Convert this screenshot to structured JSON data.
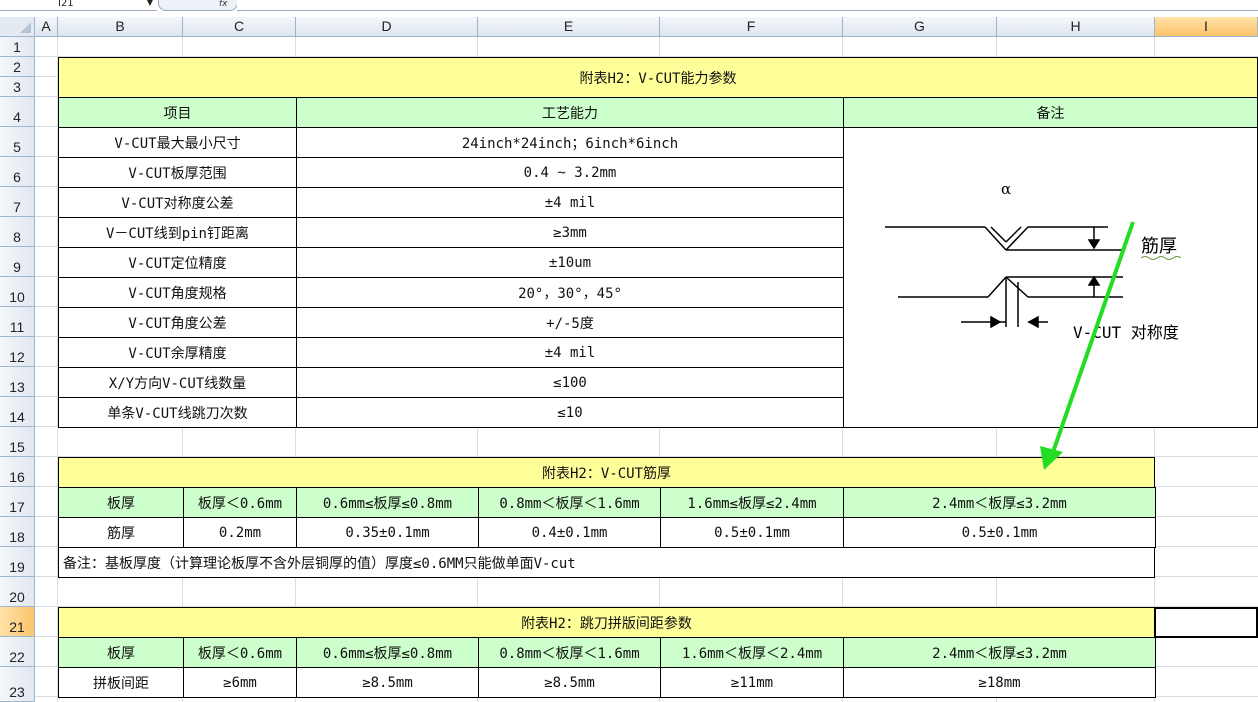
{
  "name_box": {
    "value": "I21"
  },
  "formula_bar": {
    "fx_label": "fx",
    "value": ""
  },
  "columns": [
    {
      "id": "col-a",
      "label": "A"
    },
    {
      "id": "col-b",
      "label": "B"
    },
    {
      "id": "col-c",
      "label": "C"
    },
    {
      "id": "col-d",
      "label": "D"
    },
    {
      "id": "col-e",
      "label": "E"
    },
    {
      "id": "col-f",
      "label": "F"
    },
    {
      "id": "col-g",
      "label": "G"
    },
    {
      "id": "col-h",
      "label": "H"
    },
    {
      "id": "col-i",
      "label": "I"
    }
  ],
  "rows": [
    "1",
    "2",
    "3",
    "4",
    "5",
    "6",
    "7",
    "8",
    "9",
    "10",
    "11",
    "12",
    "13",
    "14",
    "15",
    "16",
    "17",
    "18",
    "19",
    "20",
    "21",
    "22",
    "23"
  ],
  "selected": {
    "column": "I",
    "row": "21"
  },
  "colors": {
    "title_fill": "#ffff99",
    "header_fill": "#ccffcc",
    "selected_header": "#fbc46a",
    "arrow": "#22dd22"
  },
  "table1": {
    "title": "附表H2：V-CUT能力参数",
    "headers": {
      "item": "项目",
      "capability": "工艺能力",
      "remark": "备注"
    },
    "rows": [
      {
        "item": "V-CUT最大最小尺寸",
        "value": "24inch*24inch；6inch*6inch"
      },
      {
        "item": "V-CUT板厚范围",
        "value": "0.4 ~ 3.2mm"
      },
      {
        "item": "V-CUT对称度公差",
        "value": "±4 mil"
      },
      {
        "item": "V－CUT线到pin钉距离",
        "value": "≥3mm"
      },
      {
        "item": "V-CUT定位精度",
        "value": "±10um"
      },
      {
        "item": "V-CUT角度规格",
        "value": "20°，30°，45°"
      },
      {
        "item": "V-CUT角度公差",
        "value": "+/-5度"
      },
      {
        "item": "V-CUT余厚精度",
        "value": "±4 mil"
      },
      {
        "item": "X/Y方向V-CUT线数量",
        "value": "≤100"
      },
      {
        "item": "单条V-CUT线跳刀次数",
        "value": "≤10"
      }
    ],
    "diagram": {
      "alpha": "α",
      "rib_label": "筋厚",
      "symmetry_label": "V-CUT 对称度"
    }
  },
  "table2": {
    "title": "附表H2：V-CUT筋厚",
    "header_label": "板厚",
    "ranges": [
      "板厚＜0.6mm",
      "0.6mm≤板厚≤0.8mm",
      "0.8mm＜板厚＜1.6mm",
      "1.6mm≤板厚≤2.4mm",
      "2.4mm＜板厚≤3.2mm"
    ],
    "row_label": "筋厚",
    "values": [
      "0.2mm",
      "0.35±0.1mm",
      "0.4±0.1mm",
      "0.5±0.1mm",
      "0.5±0.1mm"
    ],
    "note": "备注：基板厚度（计算理论板厚不含外层铜厚的值）厚度≤0.6MM只能做单面V-cut"
  },
  "table3": {
    "title": "附表H2：跳刀拼版间距参数",
    "header_label": "板厚",
    "ranges": [
      "板厚＜0.6mm",
      "0.6mm≤板厚≤0.8mm",
      "0.8mm＜板厚＜1.6mm",
      "1.6mm＜板厚＜2.4mm",
      "2.4mm＜板厚≤3.2mm"
    ],
    "row_label": "拼板间距",
    "values": [
      "≥6mm",
      "≥8.5mm",
      "≥8.5mm",
      "≥11mm",
      "≥18mm"
    ]
  }
}
